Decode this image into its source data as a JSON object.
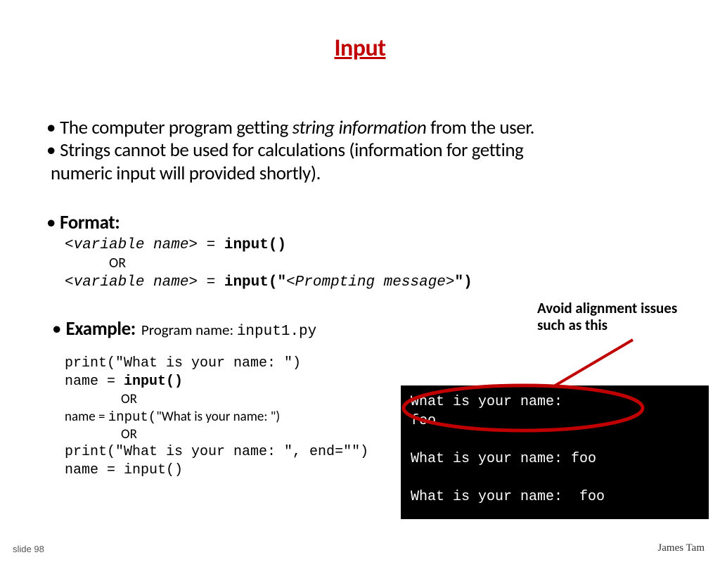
{
  "title": "Input",
  "bullets": {
    "b1_pre": "The computer program getting ",
    "b1_em": "string information",
    "b1_post": " from the user.",
    "b2": "Strings cannot be used for calculations (information for getting",
    "b2_cont": "numeric input will provided shortly)."
  },
  "format": {
    "label": "Format:",
    "line1_a": "<variable name>",
    "line1_b": " = ",
    "line1_c": "input()",
    "or": "OR",
    "line2_a": "<variable name>",
    "line2_b": " = ",
    "line2_c": "input(\"",
    "line2_d": "<Prompting message>",
    "line2_e": "\")"
  },
  "example": {
    "label": "Example:",
    "program_text": "Program name: ",
    "program_file": "input1.py",
    "l1": "print(\"What is your name: \")",
    "l2_a": "name = ",
    "l2_b": "input()",
    "or": "OR",
    "l3_a": "name = ",
    "l3_b": "input(",
    "l3_c": "\"What is your name: \")",
    "l4": "print(\"What is your name: \", end=\"\")",
    "l5": "name = input()"
  },
  "callout": {
    "l1": "Avoid alignment issues",
    "l2": "such as  this"
  },
  "terminal": {
    "l1": "What is your name:",
    "l2": "foo",
    "l3": "",
    "l4": "What is your name: foo",
    "l5": "",
    "l6": "What is your name:  foo"
  },
  "footer": {
    "slide": "slide 98",
    "author": "James Tam"
  }
}
